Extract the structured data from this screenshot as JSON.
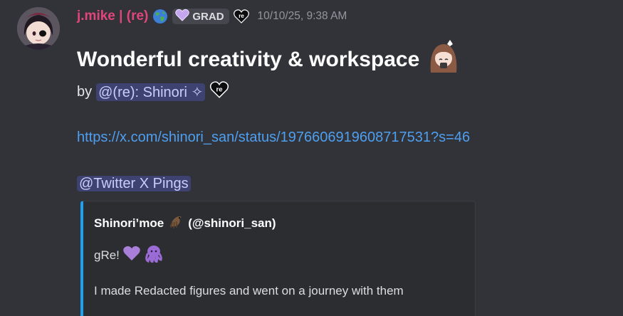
{
  "message": {
    "author": {
      "username": "j.mike | (re)",
      "tag_label": "GRAD",
      "badge_text": "re",
      "avatar": "avatar-anime-girl"
    },
    "timestamp": "10/10/25, 9:38 AM",
    "title": "Wonderful creativity & workspace",
    "by_prefix": "by",
    "mention_user": "@(re): Shinori ✧",
    "mention_badge_text": "re",
    "link": "https://x.com/shinori_san/status/1976606919608717531?s=46",
    "role_ping": "@Twitter X Pings",
    "embed": {
      "author": "Shinori’moe",
      "handle": "(@shinori_san)",
      "line1_text": "gRe!",
      "line2_text": "I made Redacted figures and went on a journey with them",
      "accent_color": "#1da1f2"
    }
  },
  "colors": {
    "background": "#323339",
    "username": "#e0457b",
    "link": "#4e9ff0",
    "mention_bg": "#3e4270",
    "mention_text": "#c9cdfb"
  }
}
